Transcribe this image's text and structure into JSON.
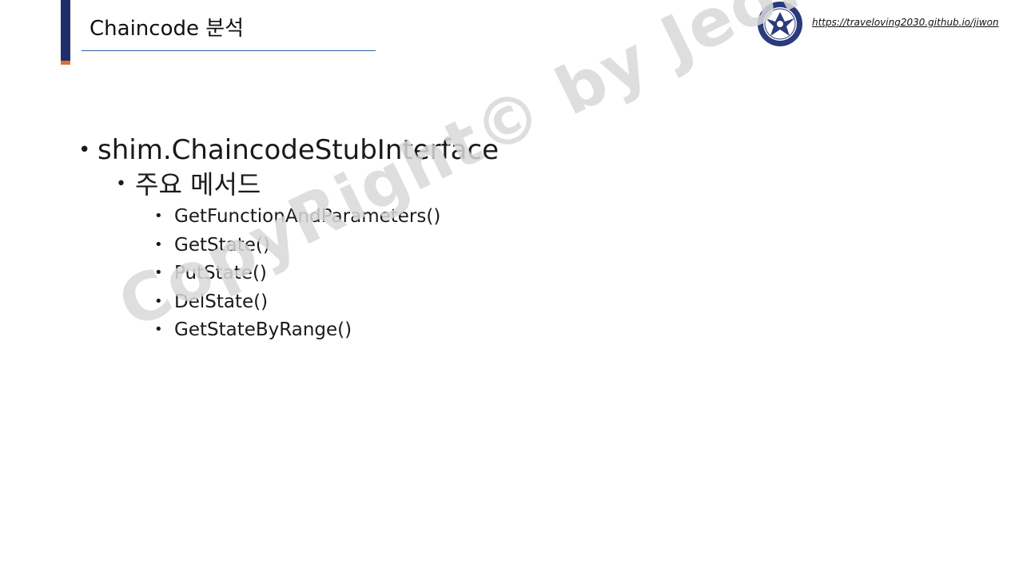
{
  "header": {
    "title": "Chaincode 분석",
    "link_text": "https://traveloving2030.github.io/jiwon",
    "logo_icon": "university-emblem-icon"
  },
  "content": {
    "level1": "shim.ChaincodeStubInterface",
    "level2": "주요 메서드",
    "methods": [
      "GetFunctionAndParameters()",
      "GetState()",
      "PutState()",
      "DelState()",
      "GetStateByRange()"
    ]
  },
  "watermark": "CopyRight© by Jeong JiWon",
  "colors": {
    "accent_navy": "#1f2f6b",
    "accent_orange": "#e0702a",
    "underline_blue": "#2d5fa3",
    "watermark_gray": "#d9d9d9"
  }
}
